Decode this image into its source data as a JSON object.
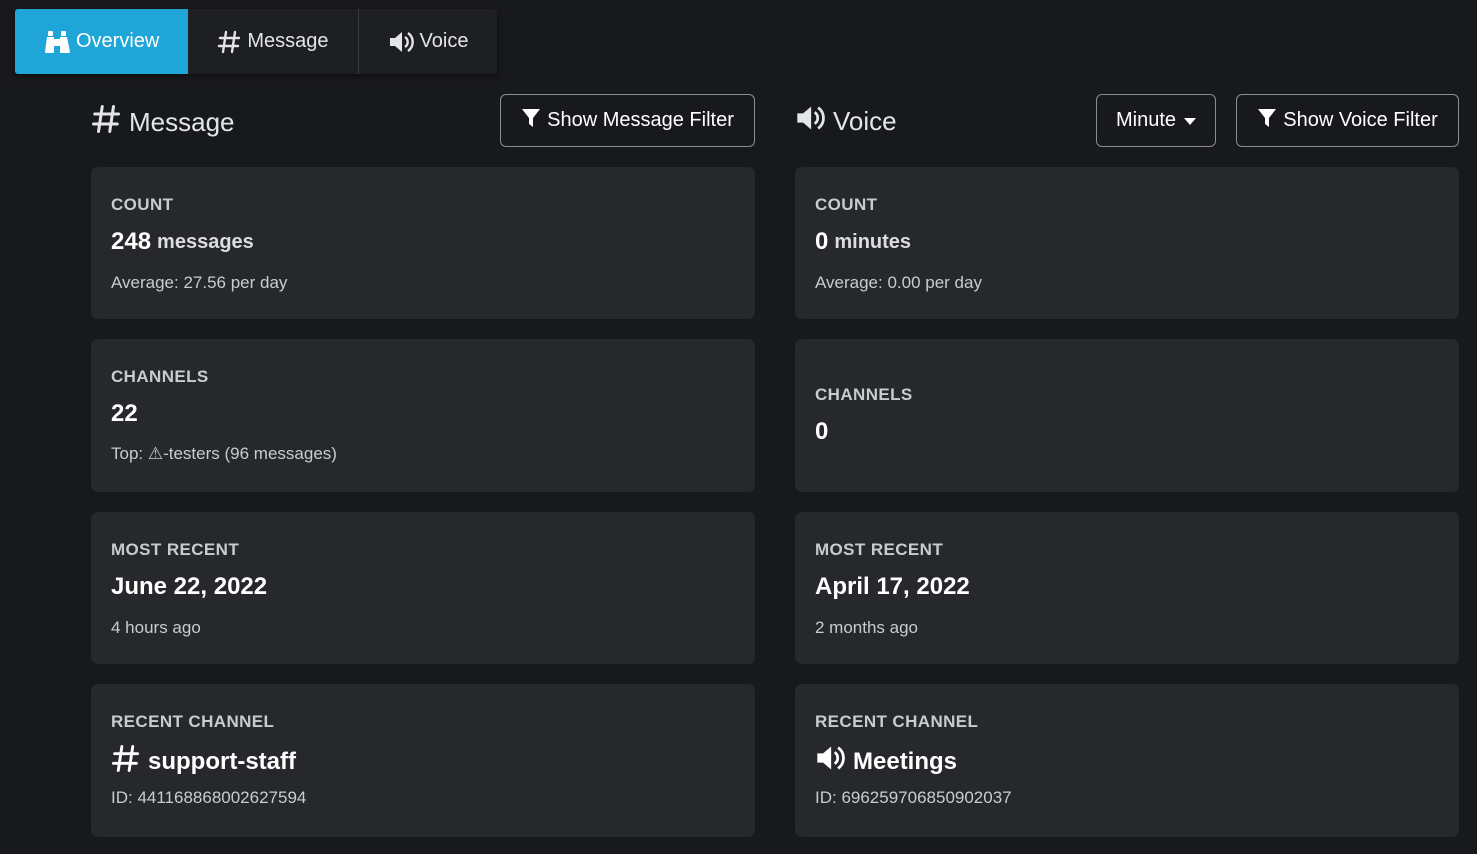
{
  "tabs": [
    {
      "label": "Overview",
      "icon": "binoculars-icon",
      "active": true
    },
    {
      "label": "Message",
      "icon": "hash-icon",
      "active": false
    },
    {
      "label": "Voice",
      "icon": "speaker-icon",
      "active": false
    }
  ],
  "colors": {
    "accent": "#1fa5d8",
    "background": "#18191c",
    "card": "#26282c"
  },
  "message": {
    "title": "Message",
    "filter_button": "Show Message Filter",
    "count": {
      "label": "COUNT",
      "value": "248",
      "unit": "messages",
      "sub": "Average: 27.56 per day"
    },
    "channels": {
      "label": "CHANNELS",
      "value": "22",
      "sub": "Top: ⚠-testers (96 messages)"
    },
    "most_recent": {
      "label": "MOST RECENT",
      "value": "June 22, 2022",
      "sub": "4 hours ago"
    },
    "recent_channel": {
      "label": "RECENT CHANNEL",
      "value": "support-staff",
      "sub": "ID: 441168868002627594"
    }
  },
  "voice": {
    "title": "Voice",
    "unit_dropdown": "Minute",
    "filter_button": "Show Voice Filter",
    "count": {
      "label": "COUNT",
      "value": "0",
      "unit": "minutes",
      "sub": "Average: 0.00 per day"
    },
    "channels": {
      "label": "CHANNELS",
      "value": "0"
    },
    "most_recent": {
      "label": "MOST RECENT",
      "value": "April 17, 2022",
      "sub": "2 months ago"
    },
    "recent_channel": {
      "label": "RECENT CHANNEL",
      "value": "Meetings",
      "sub": "ID: 696259706850902037"
    }
  }
}
